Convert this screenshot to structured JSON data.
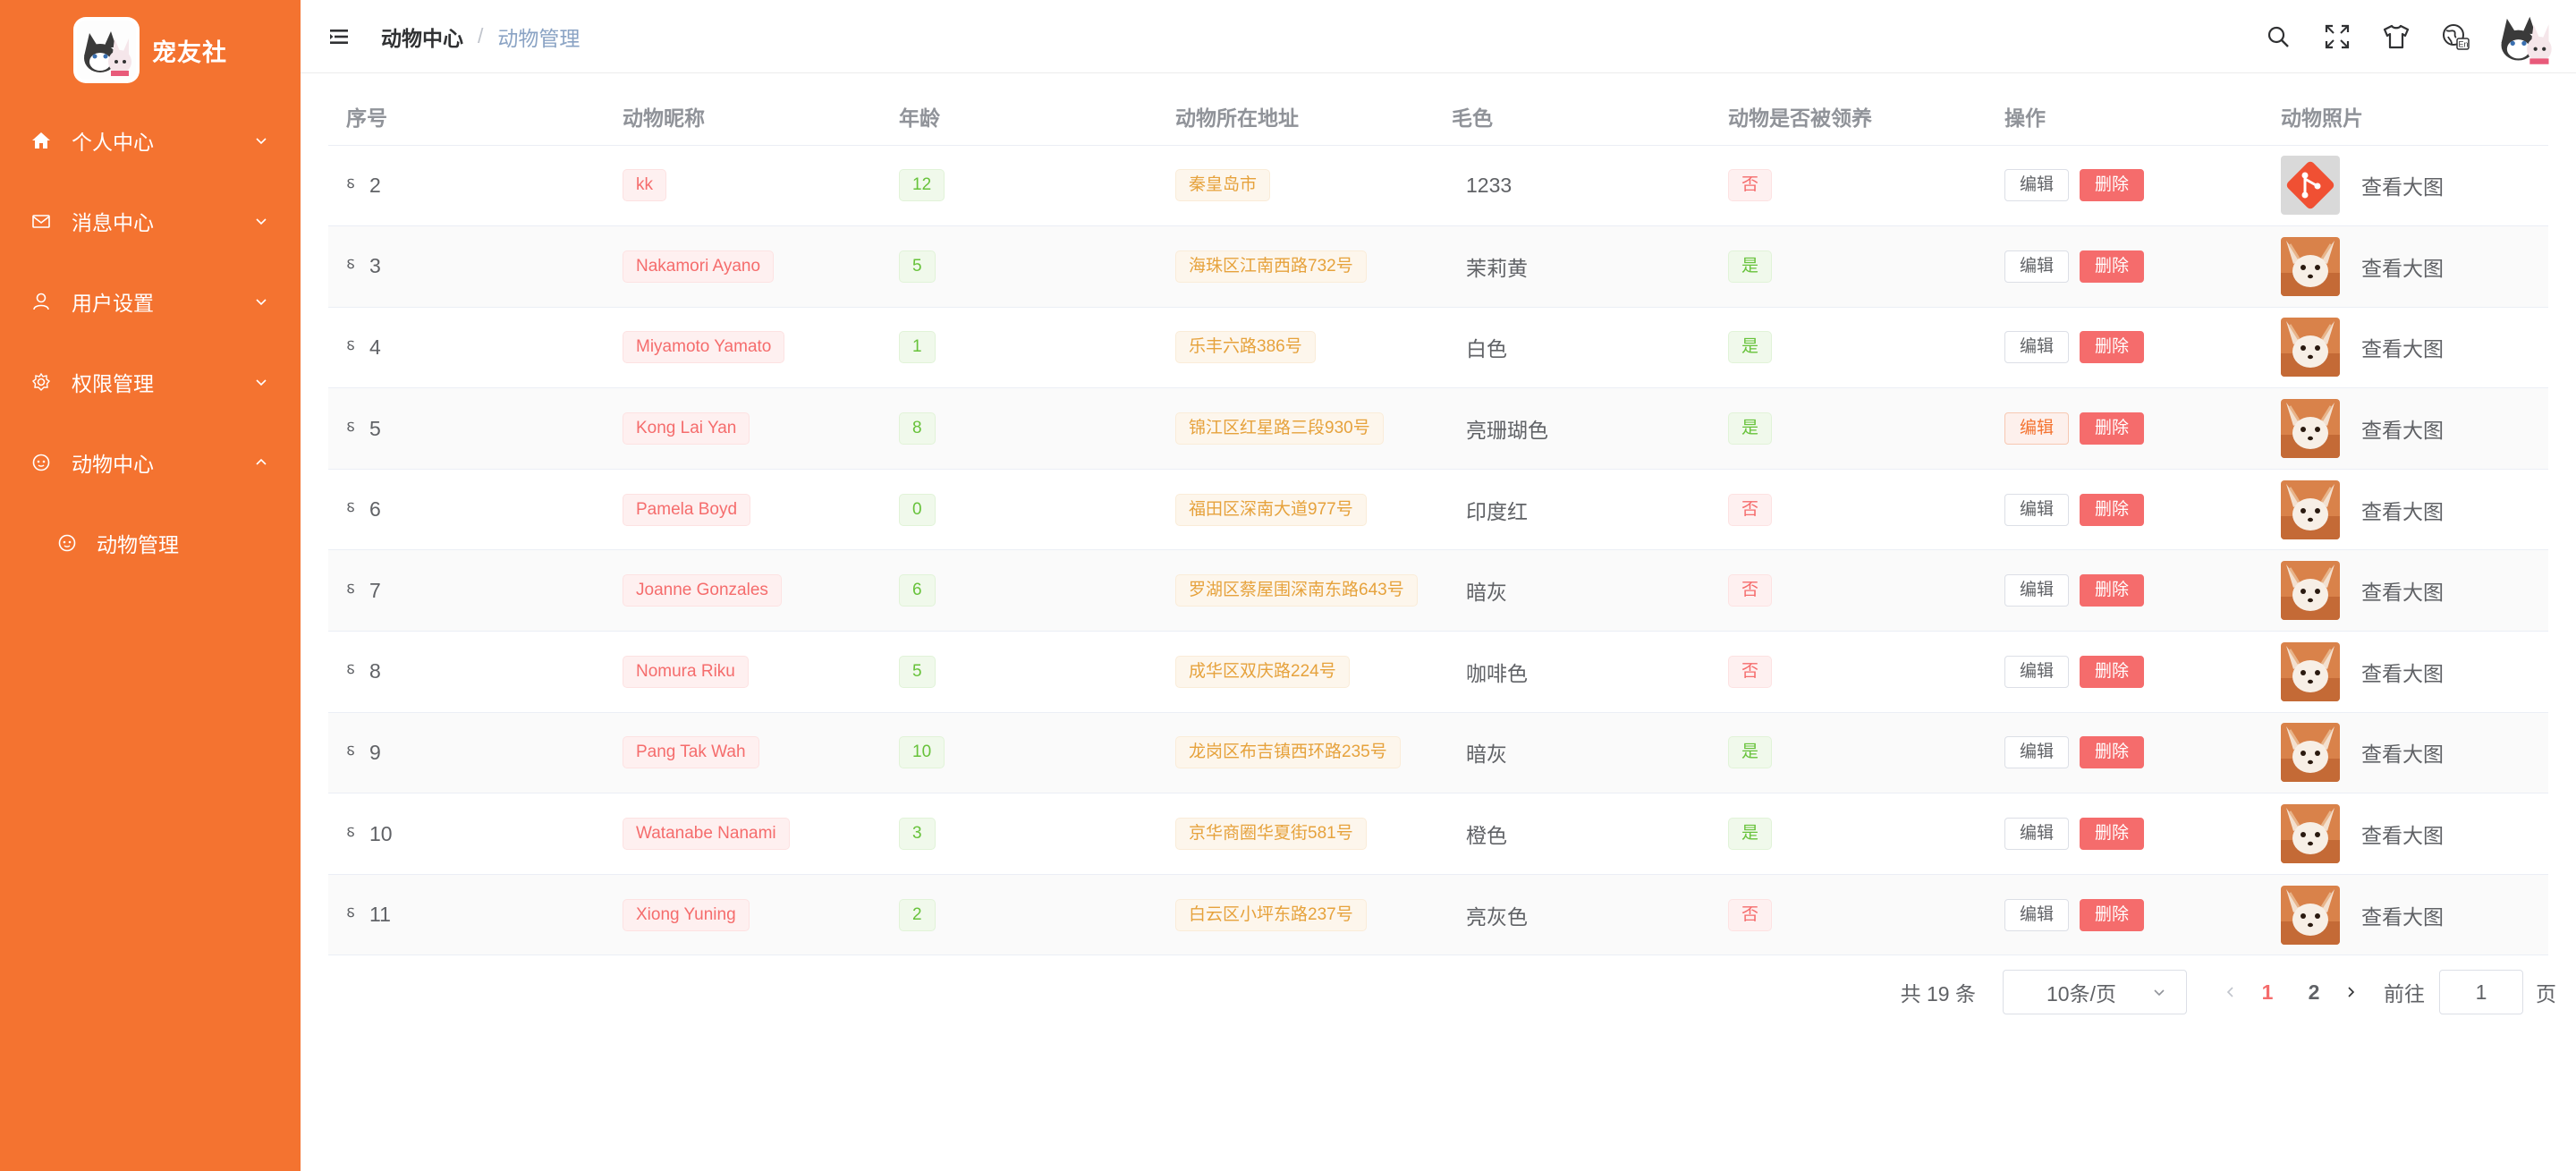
{
  "sidebar": {
    "logo_title": "宠友社",
    "menu": [
      {
        "label": "个人中心",
        "icon": "home-icon"
      },
      {
        "label": "消息中心",
        "icon": "mail-icon"
      },
      {
        "label": "用户设置",
        "icon": "user-icon"
      },
      {
        "label": "权限管理",
        "icon": "gear-icon"
      },
      {
        "label": "动物中心",
        "icon": "pet-icon",
        "expanded": true
      }
    ],
    "submenu": [
      {
        "label": "动物管理",
        "icon": "pet-icon"
      }
    ]
  },
  "header": {
    "breadcrumb": [
      "动物中心",
      "动物管理"
    ],
    "breadcrumb_separator": "/",
    "tools": [
      "search-icon",
      "fullscreen-icon",
      "theme-shirt-icon",
      "language-icon"
    ]
  },
  "table": {
    "columns": [
      "序号",
      "动物昵称",
      "年龄",
      "动物所在地址",
      "毛色",
      "动物是否被领养",
      "操作",
      "动物照片"
    ],
    "edit_label": "编辑",
    "delete_label": "删除",
    "view_label": "查看大图",
    "rows": [
      {
        "id": "2",
        "name": "kk",
        "age": "12",
        "address": "秦皇岛市",
        "color": "1233",
        "adopted": "否",
        "photo": "git-logo"
      },
      {
        "id": "3",
        "name": "Nakamori Ayano",
        "age": "5",
        "address": "海珠区江南西路732号",
        "color": "茉莉黄",
        "adopted": "是",
        "photo": "fox"
      },
      {
        "id": "4",
        "name": "Miyamoto Yamato",
        "age": "1",
        "address": "乐丰六路386号",
        "color": "白色",
        "adopted": "是",
        "photo": "fox"
      },
      {
        "id": "5",
        "name": "Kong Lai Yan",
        "age": "8",
        "address": "锦江区红星路三段930号",
        "color": "亮珊瑚色",
        "adopted": "是",
        "photo": "fox"
      },
      {
        "id": "6",
        "name": "Pamela Boyd",
        "age": "0",
        "address": "福田区深南大道977号",
        "color": "印度红",
        "adopted": "否",
        "photo": "fox"
      },
      {
        "id": "7",
        "name": "Joanne Gonzales",
        "age": "6",
        "address": "罗湖区蔡屋围深南东路643号",
        "color": "暗灰",
        "adopted": "否",
        "photo": "fox"
      },
      {
        "id": "8",
        "name": "Nomura Riku",
        "age": "5",
        "address": "成华区双庆路224号",
        "color": "咖啡色",
        "adopted": "否",
        "photo": "fox"
      },
      {
        "id": "9",
        "name": "Pang Tak Wah",
        "age": "10",
        "address": "龙岗区布吉镇西环路235号",
        "color": "暗灰",
        "adopted": "是",
        "photo": "fox"
      },
      {
        "id": "10",
        "name": "Watanabe Nanami",
        "age": "3",
        "address": "京华商圈华夏街581号",
        "color": "橙色",
        "adopted": "是",
        "photo": "fox"
      },
      {
        "id": "11",
        "name": "Xiong Yuning",
        "age": "2",
        "address": "白云区小坪东路237号",
        "color": "亮灰色",
        "adopted": "否",
        "photo": "fox"
      }
    ]
  },
  "pagination": {
    "total": "共 19 条",
    "page_size": "10条/页",
    "pages": [
      "1",
      "2"
    ],
    "current_page": "1",
    "goto_prefix": "前往",
    "goto_value": "1",
    "goto_suffix": "页"
  },
  "colors": {
    "sidebar_bg": "#f47330",
    "danger": "#f56c6c",
    "success": "#67c23a",
    "warning": "#e6a23c"
  }
}
